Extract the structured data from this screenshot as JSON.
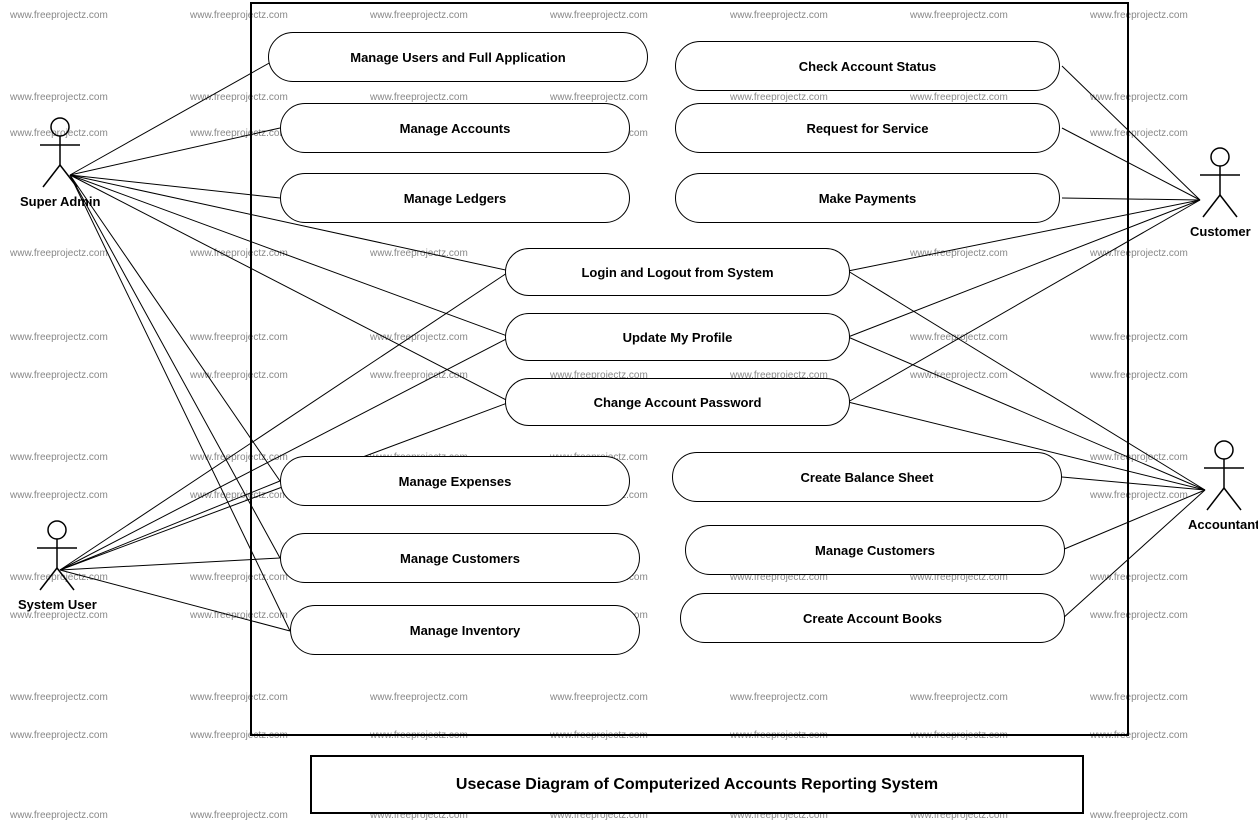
{
  "title": "Usecase Diagram of Computerized Accounts Reporting System",
  "watermark_text": "www.freeprojectz.com",
  "actors": {
    "super_admin": "Super Admin",
    "system_user": "System User",
    "customer": "Customer",
    "accountant": "Accountant"
  },
  "usecases": {
    "uc1": "Manage Users and Full Application",
    "uc2": "Manage Accounts",
    "uc3": "Manage Ledgers",
    "uc4": "Check Account Status",
    "uc5": "Request for Service",
    "uc6": "Make Payments",
    "uc7": "Login and Logout from System",
    "uc8": "Update My Profile",
    "uc9": "Change Account Password",
    "uc10": "Manage Expenses",
    "uc11": "Manage Customers",
    "uc12": "Manage Inventory",
    "uc13": "Create Balance Sheet",
    "uc14": "Manage Customers",
    "uc15": "Create Account Books"
  }
}
